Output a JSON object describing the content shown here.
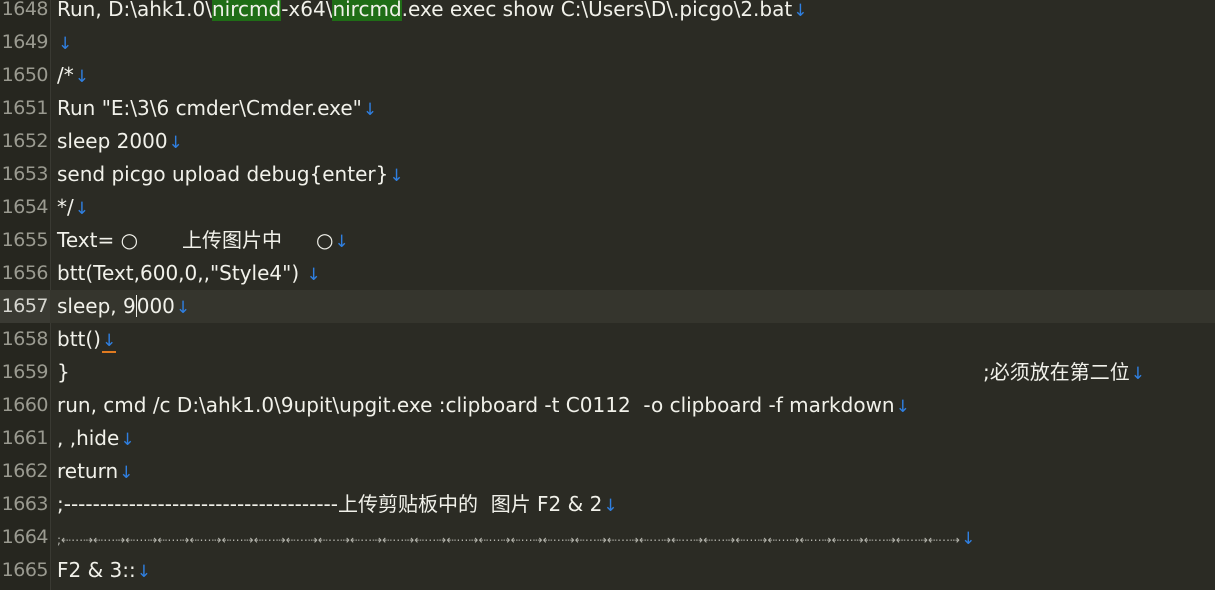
{
  "editor": {
    "lines": [
      {
        "num": "1648",
        "parts": [
          "Run, D:\\ahk1.0\\",
          "nircmd",
          "-x64\\",
          "nircmd",
          ".exe exec show C:\\Users\\D\\.picgo\\2.bat"
        ]
      },
      {
        "num": "1649",
        "text": ""
      },
      {
        "num": "1650",
        "text": "/*"
      },
      {
        "num": "1651",
        "text": "Run \"E:\\3\\6 cmder\\Cmder.exe\""
      },
      {
        "num": "1652",
        "text": "sleep 2000"
      },
      {
        "num": "1653",
        "text": "send picgo upload debug{enter}"
      },
      {
        "num": "1654",
        "text": "*/"
      },
      {
        "num": "1655",
        "parts": [
          "Text= ○",
          "上传图片中",
          "○"
        ]
      },
      {
        "num": "1656",
        "text": "btt(Text,600,0,,\"Style4\") "
      },
      {
        "num": "1657",
        "parts": [
          "sleep, 9",
          "000"
        ]
      },
      {
        "num": "1658",
        "text": "btt()"
      },
      {
        "num": "1659",
        "text": "}",
        "comment": ";必须放在第二位"
      },
      {
        "num": "1660",
        "text": "run, cmd /c D:\\ahk1.0\\9upit\\upgit.exe :clipboard -t C0112  -o clipboard -f markdown"
      },
      {
        "num": "1661",
        "text": ", ,hide"
      },
      {
        "num": "1662",
        "text": "return"
      },
      {
        "num": "1663",
        "text": ";--------------------------------------上传剪贴板中的  图片 F2 & 2"
      },
      {
        "num": "1664",
        "text": ";⇠⋯⇢⇠⋯⇢⇠⋯⇢⇠⋯⇢⇠⋯⇢⇠⋯⇢⇠⋯⇢⇠⋯⇢⇠⋯⇢⇠⋯⇢⇠⋯⇢⇠⋯⇢⇠⋯⇢⇠⋯⇢⇠⋯⇢⇠⋯⇢⇠⋯⇢⇠⋯⇢⇠⋯⇢⇠⋯⇢⇠⋯⇢⇠⋯⇢⇠⋯⇢⇠⋯⇢⇠⋯⇢⇠⋯⇢⇠⋯⇢⇠⋯⇢"
      },
      {
        "num": "1665",
        "text": "F2 & 3::"
      }
    ],
    "newline_glyph": "↓"
  }
}
